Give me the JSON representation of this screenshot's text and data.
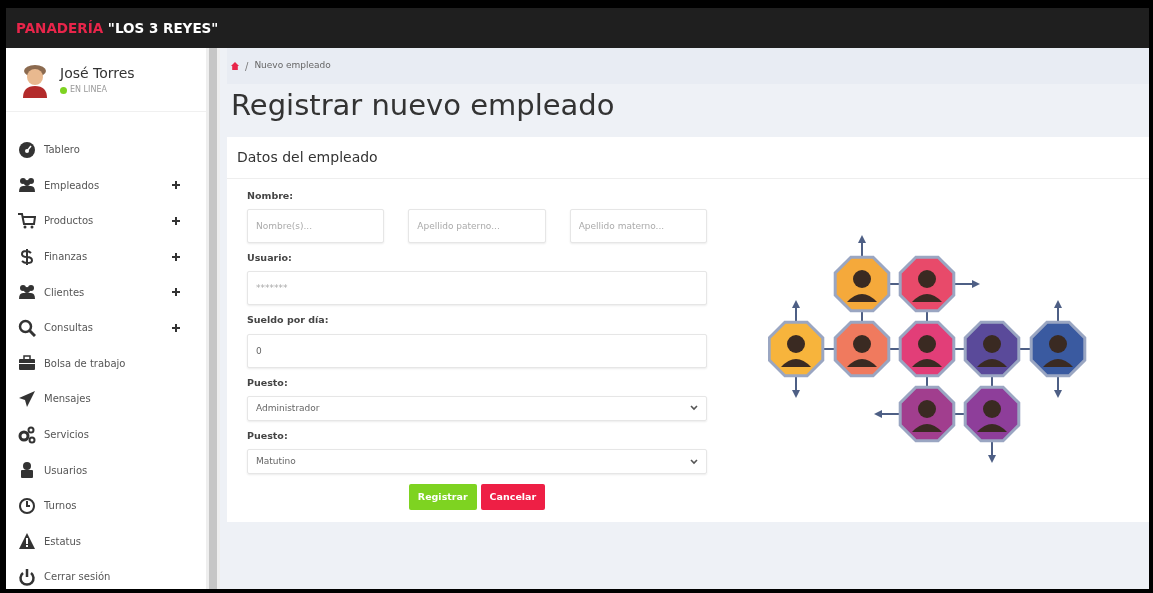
{
  "brand": {
    "highlight": "PANADERÍA",
    "rest": "\"LOS 3 REYES\""
  },
  "user": {
    "name": "José Torres",
    "status": "EN LINEA",
    "online": true
  },
  "sidebar": {
    "items": [
      {
        "label": "Tablero",
        "has_submenu": false
      },
      {
        "label": "Empleados",
        "has_submenu": true
      },
      {
        "label": "Productos",
        "has_submenu": true
      },
      {
        "label": "Finanzas",
        "has_submenu": true
      },
      {
        "label": "Clientes",
        "has_submenu": true
      },
      {
        "label": "Consultas",
        "has_submenu": true
      },
      {
        "label": "Bolsa de trabajo",
        "has_submenu": false
      },
      {
        "label": "Mensajes",
        "has_submenu": false
      },
      {
        "label": "Servicios",
        "has_submenu": false
      },
      {
        "label": "Usuarios",
        "has_submenu": false
      },
      {
        "label": "Turnos",
        "has_submenu": false
      },
      {
        "label": "Estatus",
        "has_submenu": false
      },
      {
        "label": "Cerrar sesión",
        "has_submenu": false
      }
    ]
  },
  "breadcrumb": {
    "separator": "/",
    "current": "Nuevo empleado"
  },
  "page_title": "Registrar nuevo empleado",
  "card": {
    "title": "Datos del empleado",
    "fields": [
      {
        "kind": "text_group",
        "label": "Nombre:",
        "inputs": [
          {
            "placeholder": "Nombre(s)..."
          },
          {
            "placeholder": "Apellido paterno..."
          },
          {
            "placeholder": "Apellido materno..."
          }
        ]
      },
      {
        "kind": "text",
        "label": "Usuario:",
        "placeholder": "*******"
      },
      {
        "kind": "text",
        "label": "Sueldo por día:",
        "value": "0"
      },
      {
        "kind": "select",
        "label": "Puesto:",
        "value": "Administrador"
      },
      {
        "kind": "select",
        "label": "Puesto:",
        "value": "Matutino"
      }
    ],
    "buttons": [
      {
        "label": "Registrar",
        "kind": "submit"
      },
      {
        "label": "Cancelar",
        "kind": "cancel"
      }
    ]
  }
}
